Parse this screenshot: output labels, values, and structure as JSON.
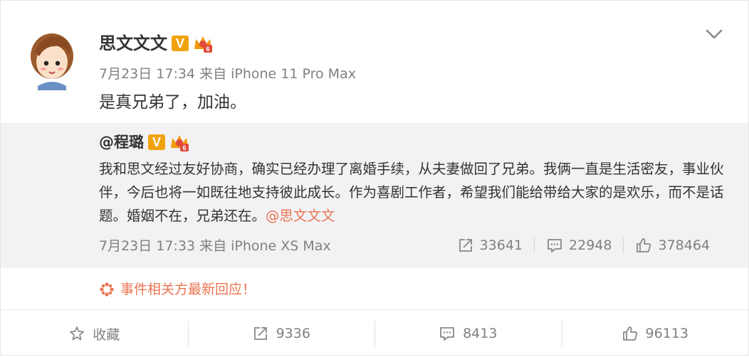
{
  "post": {
    "author": "思文文文",
    "time": "7月23日 17:34",
    "source": "来自 iPhone 11 Pro Max",
    "text": "是真兄弟了，加油。",
    "badge_v": "V"
  },
  "repost": {
    "author": "@程璐",
    "badge_v": "V",
    "text": "我和思文经过友好协商，确实已经办理了离婚手续，从夫妻做回了兄弟。我俩一直是生活密友，事业伙伴，今后也将一如既往地支持彼此成长。作为喜剧工作者，希望我们能给带给大家的是欢乐，而不是话题。婚姻不在，兄弟还在。",
    "mention": "@思文文文",
    "time": "7月23日 17:33",
    "source": "来自 iPhone XS Max",
    "reposts": "33641",
    "comments": "22948",
    "likes": "378464"
  },
  "topic": {
    "label": "事件相关方最新回应！",
    "icon": "topic-flower-icon"
  },
  "bottom_bar": {
    "favorite": "收藏",
    "reposts": "9336",
    "comments": "8413",
    "likes": "96113"
  },
  "colors": {
    "accent_orange": "#eb7350",
    "gold_badge": "#f0a20c",
    "muted_text": "#808080",
    "repost_bg": "#f2f2f5"
  }
}
